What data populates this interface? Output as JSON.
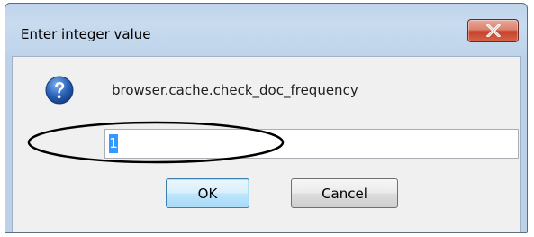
{
  "dialog": {
    "title": "Enter integer value",
    "close_icon": "close-x-icon",
    "prompt_icon": "question-icon",
    "pref_name": "browser.cache.check_doc_frequency",
    "input_value": "1",
    "ok_label": "OK",
    "cancel_label": "Cancel"
  },
  "colors": {
    "title_bar": "#c8dbef",
    "close_button": "#c7412a",
    "selection": "#3399ff",
    "icon_blue": "#2a63b8",
    "annotation": "#000000"
  }
}
